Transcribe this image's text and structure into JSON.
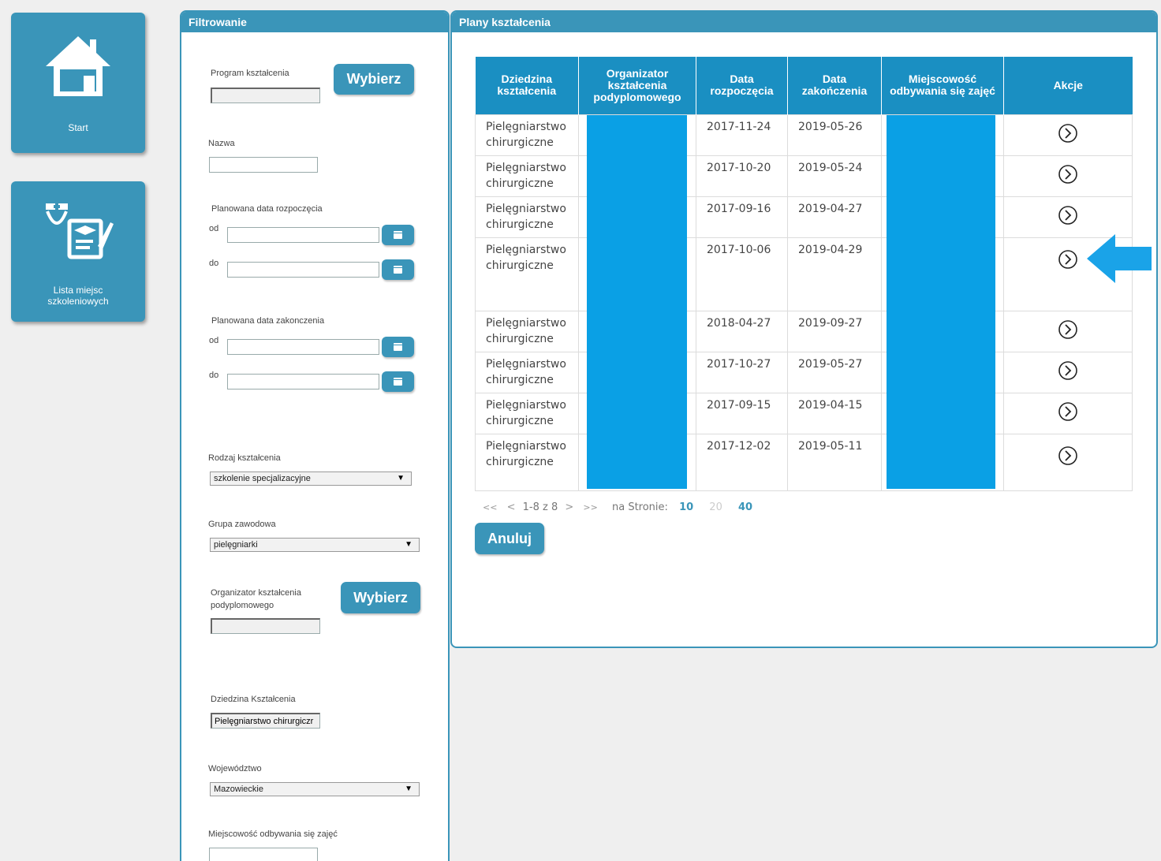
{
  "nav": {
    "start_label": "Start",
    "places_label": "Lista miejsc szkoleniowych"
  },
  "filter": {
    "title": "Filtrowanie",
    "program_label": "Program kształcenia",
    "program_value": "",
    "choose_label": "Wybierz",
    "name_label": "Nazwa",
    "name_value": "",
    "start_date_label": "Planowana data rozpoczęcia",
    "end_date_label": "Planowana data zakonczenia",
    "from_label": "od",
    "to_label": "do",
    "kind_label": "Rodzaj kształcenia",
    "kind_value": "szkolenie specjalizacyjne",
    "group_label": "Grupa zawodowa",
    "group_value": "pielęgniarki",
    "organizer_label": "Organizator kształcenia podyplomowego",
    "organizer_value": "",
    "field_label": "Dziedzina Kształcenia",
    "field_value": "Pielęgniarstwo chirurgiczr",
    "voivodeship_label": "Województwo",
    "voivodeship_value": "Mazowieckie",
    "place_label": "Miejscowość odbywania się zajęć",
    "place_value": ""
  },
  "plans": {
    "title": "Plany kształcenia",
    "headers": [
      "Dziedzina kształcenia",
      "Organizator kształcenia podyplomowego",
      "Data rozpoczęcia",
      "Data zakończenia",
      "Miejscowość odbywania się zajęć",
      "Akcje"
    ],
    "rows": [
      {
        "field": "Pielęgniarstwo chirurgiczne",
        "start": "2017-11-24",
        "end": "2019-05-26"
      },
      {
        "field": "Pielęgniarstwo chirurgiczne",
        "start": "2017-10-20",
        "end": "2019-05-24"
      },
      {
        "field": "Pielęgniarstwo chirurgiczne",
        "start": "2017-09-16",
        "end": "2019-04-27"
      },
      {
        "field": "Pielęgniarstwo chirurgiczne",
        "start": "2017-10-06",
        "end": "2019-04-29"
      },
      {
        "field": "Pielęgniarstwo chirurgiczne",
        "start": "2018-04-27",
        "end": "2019-09-27"
      },
      {
        "field": "Pielęgniarstwo chirurgiczne",
        "start": "2017-10-27",
        "end": "2019-05-27"
      },
      {
        "field": "Pielęgniarstwo chirurgiczne",
        "start": "2017-09-15",
        "end": "2019-04-15"
      },
      {
        "field": "Pielęgniarstwo chirurgiczne",
        "start": "2017-12-02",
        "end": "2019-05-11"
      }
    ],
    "pager": {
      "first": "<<",
      "prev": "<",
      "range": "1-8 z 8",
      "next": ">",
      "last": ">>",
      "per_page_label": "na Stronie:",
      "opt10": "10",
      "opt20": "20",
      "opt40": "40"
    },
    "cancel_label": "Anuluj",
    "highlight_color": "#1aa3e8",
    "redaction_color": "#0aa0e5"
  }
}
